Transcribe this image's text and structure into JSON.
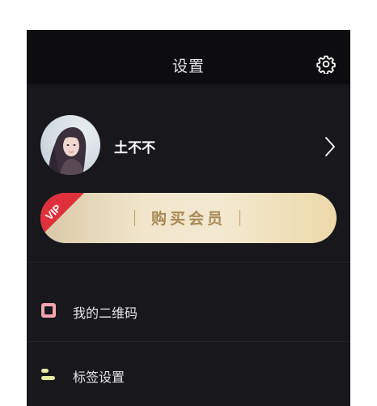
{
  "header": {
    "title": "设置",
    "settings_icon": "gear-icon"
  },
  "profile": {
    "username": "土不不",
    "avatar_icon": "user-avatar",
    "arrow_icon": "chevron-right-icon"
  },
  "vip": {
    "ribbon_text": "VIP",
    "label": "购买会员",
    "ribbon_color": "#e0303c"
  },
  "menu": {
    "items": [
      {
        "label": "我的二维码",
        "icon": "qr-code-icon",
        "icon_color": "#f2a4ae"
      },
      {
        "label": "标签设置",
        "icon": "tag-settings-icon",
        "icon_color": "#e6e8a0"
      }
    ]
  },
  "colors": {
    "background": "#17171c",
    "header_background": "#0d0d10",
    "vip_gold": "#a88a57"
  }
}
